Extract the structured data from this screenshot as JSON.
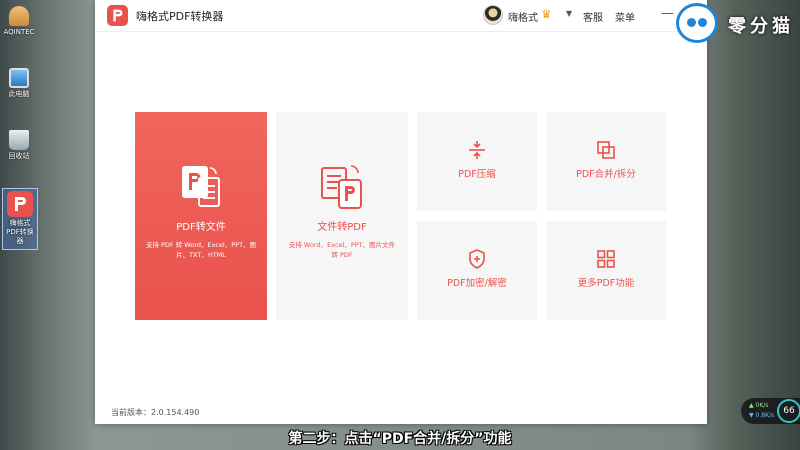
{
  "desktop": {
    "icons": [
      {
        "label": "AQINTEC",
        "icon": "user-folder-icon"
      },
      {
        "label": "此电脑",
        "icon": "computer-icon"
      },
      {
        "label": "回收站",
        "icon": "recycle-bin-icon"
      },
      {
        "label": "嗨格式PDF转换器",
        "icon": "pdf-app-icon"
      }
    ]
  },
  "window": {
    "title": "嗨格式PDF转换器",
    "user": {
      "name": "嗨格式"
    },
    "buttons": {
      "service": "客服",
      "menu": "菜单",
      "minimize": "—"
    },
    "tiles": {
      "pdf_to_file": {
        "title": "PDF转文件",
        "desc": "支持 PDF 转 Word、Excel、PPT、图片、TXT、HTML"
      },
      "file_to_pdf": {
        "title": "文件转PDF",
        "desc": "支持 Word、Excel、PPT、图片文件转 PDF"
      },
      "compress": {
        "title": "PDF压缩"
      },
      "merge_split": {
        "title": "PDF合并/拆分"
      },
      "encrypt": {
        "title": "PDF加密/解密"
      },
      "more": {
        "title": "更多PDF功能"
      }
    },
    "version": "当前版本：2.0.154.490"
  },
  "overlay": {
    "brand": "零分猫",
    "subtitle": "第二步：点击“PDF合并/拆分”功能",
    "network": {
      "up": "0K/s",
      "down": "0.8K/s",
      "value": "66"
    }
  },
  "colors": {
    "accent": "#e9524d",
    "tile_bg": "#f7f6f7"
  }
}
